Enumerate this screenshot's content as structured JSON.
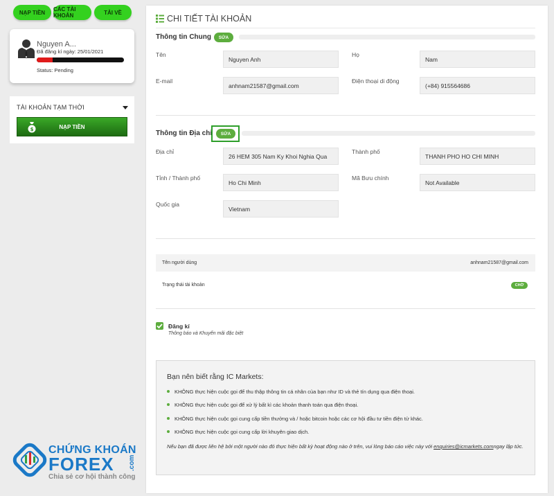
{
  "top_buttons": {
    "deposit": "NẠP TIỀN",
    "accounts": "CÁC TÀI KHOẢN",
    "download": "TẢI VỀ"
  },
  "profile": {
    "name": "Nguyen A...",
    "registered": "Đã đăng kí ngày: 25/01/2021",
    "status": "Status: Pending",
    "progress_percent": 18,
    "progress_color": "#e01b1b"
  },
  "temp_account": {
    "title": "TÀI KHOẢN TẠM THỜI",
    "deposit_label": "NẠP TIỀN"
  },
  "logo": {
    "line1": "CHỨNG KHOÁN",
    "line2": "FOREX",
    "dotcom": ".com",
    "tagline": "Chia sẻ cơ hội thành công"
  },
  "page": {
    "title": "CHI TIẾT TÀI KHOẢN"
  },
  "general": {
    "title": "Thông tin Chung",
    "edit_label": "SỬA",
    "first_name_label": "Tên",
    "first_name": "Nguyen Anh",
    "last_name_label": "Họ",
    "last_name": "Nam",
    "email_label": "E-mail",
    "email": "anhnam21587@gmail.com",
    "phone_label": "Điện thoại di động",
    "phone": "(+84) 915564686"
  },
  "address": {
    "title": "Thông tin Địa chỉ",
    "edit_label": "SỬA",
    "street_label": "Địa chỉ",
    "street": "26 HEM 305 Nam Ky Khoi Nghia Qua",
    "city_label": "Thành phố",
    "city": "THANH PHO HO CHI MINH",
    "province_label": "Tỉnh / Thành phố",
    "province": "Ho Chi Minh",
    "postal_label": "Mã Bưu chính",
    "postal": "Not Available",
    "country_label": "Quốc gia",
    "country": "Vietnam"
  },
  "account": {
    "username_label": "Tên người dùng",
    "username": "anhnam21587@gmail.com",
    "status_label": "Trạng thái tài khoản",
    "status_badge": "CHỜ"
  },
  "subscribe": {
    "checked": true,
    "label": "Đăng kí",
    "sublabel": "Thông báo và Khuyến mãi đặc biệt"
  },
  "notice": {
    "title": "Bạn nên biết rằng IC Markets:",
    "items": [
      "KHÔNG thực hiện cuộc gọi để thu thập thông tin cá nhân của bạn như ID và thẻ tín dụng qua điện thoại.",
      "KHÔNG thực hiện cuộc gọi để xử lý bất kì các khoản thanh toán qua điện thoại.",
      "KHÔNG thực hiện cuộc gọi cung cấp tiền thưởng và / hoặc bitcoin hoặc các cơ hội đầu tư tiền điện tử khác.",
      "KHÔNG thực hiện cuộc gọi cung cấp lời khuyên giao dịch."
    ],
    "footer_text": "Nếu bạn đã được liên hệ bởi một người nào đó thực hiện bất kỳ hoạt động nào ở trên, vui lòng báo cáo việc này với",
    "footer_link": "enquiries@icmarkets.com",
    "footer_tail": "ngay lập tức."
  },
  "colors": {
    "accent_green": "#5dad3e",
    "button_green": "#34d11f",
    "highlight_green": "#2d9e2a",
    "logo_blue": "#1b79c7"
  }
}
